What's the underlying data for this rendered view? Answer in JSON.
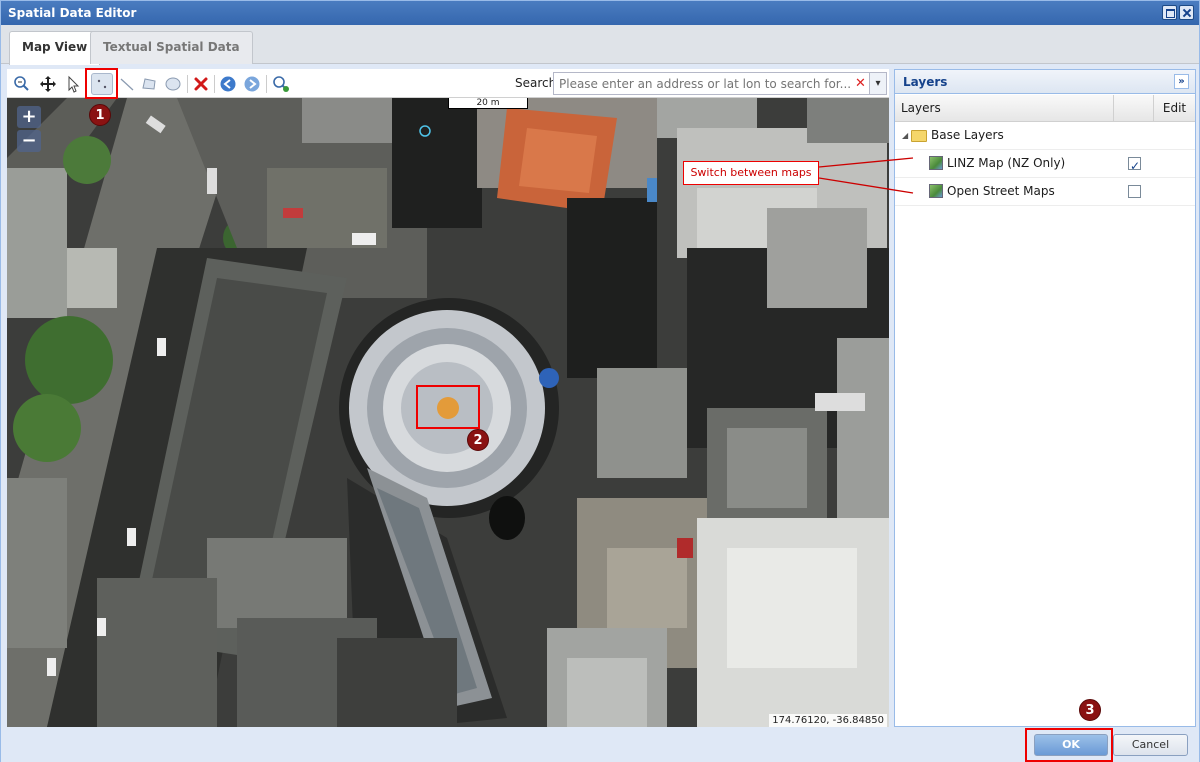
{
  "window": {
    "title": "Spatial Data Editor"
  },
  "tabs": [
    {
      "label": "Map View",
      "active": true
    },
    {
      "label": "Textual Spatial Data",
      "active": false
    }
  ],
  "toolbar": {
    "icons": [
      "zoom-extent-icon",
      "pan-icon",
      "select-pointer-icon",
      "draw-point-icon",
      "draw-line-icon",
      "draw-polygon-icon",
      "draw-circle-icon",
      "delete-icon",
      "back-icon",
      "forward-icon",
      "zoom-search-icon"
    ],
    "search_label": "Search",
    "search_placeholder": "Please enter an address or lat lon to search for...",
    "clear_glyph": "✕",
    "dropdown_glyph": "▾"
  },
  "map": {
    "zoom_in": "+",
    "zoom_out": "−",
    "scale": "20 m",
    "coordinates": "174.76120, -36.84850"
  },
  "layers_panel": {
    "title": "Layers",
    "collapse_glyph": "»",
    "columns": {
      "layers": "Layers",
      "edit": "Edit"
    },
    "group": {
      "label": "Base Layers",
      "arrow": "◢"
    },
    "items": [
      {
        "label": "LINZ Map (NZ Only)",
        "checked": true
      },
      {
        "label": "Open Street Maps",
        "checked": false
      }
    ]
  },
  "annotations": {
    "switch_maps": "Switch between maps",
    "step1": "1",
    "step2": "2",
    "step3": "3",
    "highlight_color": "#e00000",
    "callout_color": "#8a1212"
  },
  "footer": {
    "ok_label": "OK",
    "cancel_label": "Cancel"
  }
}
